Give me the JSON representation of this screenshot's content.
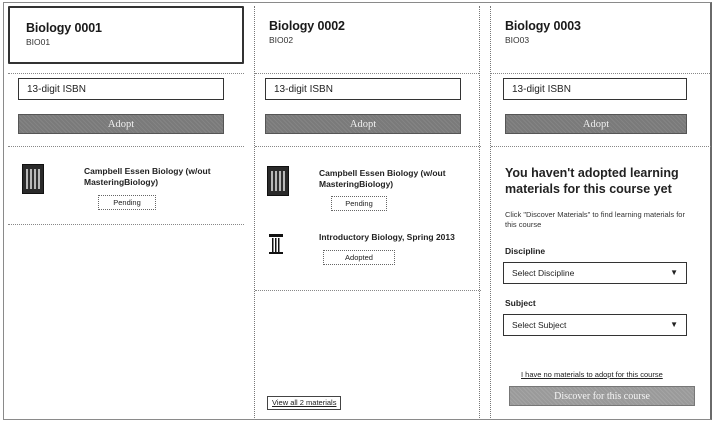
{
  "courses": [
    {
      "title": "Biology 0001",
      "code": "BIO01",
      "isbn_placeholder": "13-digit ISBN",
      "adopt_label": "Adopt",
      "materials": [
        {
          "title": "Campbell Essen Biology (w/out MasteringBiology)",
          "status": "Pending"
        }
      ]
    },
    {
      "title": "Biology 0002",
      "code": "BIO02",
      "isbn_placeholder": "13-digit ISBN",
      "adopt_label": "Adopt",
      "materials": [
        {
          "title": "Campbell Essen Biology (w/out MasteringBiology)",
          "status": "Pending"
        },
        {
          "title": "Introductory Biology, Spring 2013",
          "status": "Adopted"
        }
      ],
      "view_all_label": "View all 2 materials"
    },
    {
      "title": "Biology 0003",
      "code": "BIO03",
      "isbn_placeholder": "13-digit ISBN",
      "adopt_label": "Adopt",
      "empty_title": "You haven't adopted learning materials for this course yet",
      "empty_desc": "Click \"Discover Materials\" to find learning materials for this course",
      "discipline_label": "Discipline",
      "discipline_value": "Select Discipline",
      "subject_label": "Subject",
      "subject_value": "Select Subject",
      "no_materials_link": "I have no materials to adopt for this course",
      "discover_label": "Discover for this course"
    }
  ],
  "icons": {
    "dropdown": "chevron-down-icon",
    "book_cover": "book-cover-icon",
    "pillar_cover": "pillar-cover-icon"
  }
}
